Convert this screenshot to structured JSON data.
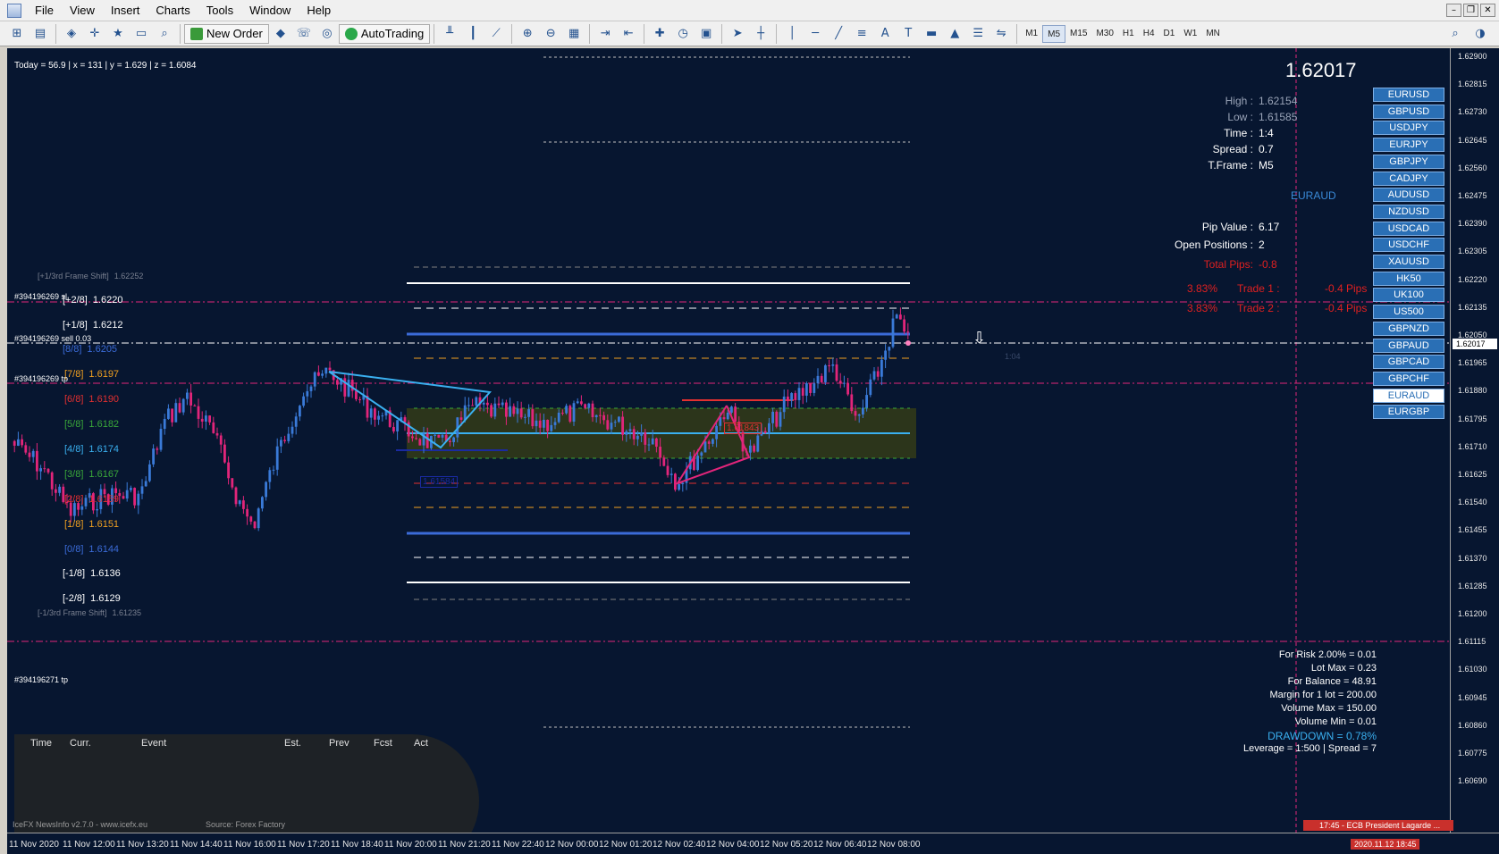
{
  "menu": [
    "File",
    "View",
    "Insert",
    "Charts",
    "Tools",
    "Window",
    "Help"
  ],
  "window_controls": [
    "–",
    "❐",
    "✕"
  ],
  "toolbar": {
    "new_order": "New Order",
    "autotrading": "AutoTrading",
    "timeframes": [
      "M1",
      "M5",
      "M15",
      "M30",
      "H1",
      "H4",
      "D1",
      "W1",
      "MN"
    ],
    "active_timeframe": "M5"
  },
  "chart": {
    "info_line": "Today = 56.9   |   x = 131   |   y = 1.629   |   z = 1.6084",
    "big_price": "1.62017",
    "symbol": "EURAUD",
    "info_panel": [
      {
        "k": "High :",
        "v": "1.62154",
        "color": "#9aa4b8"
      },
      {
        "k": "Low :",
        "v": "1.61585",
        "color": "#9aa4b8"
      },
      {
        "k": "Time :",
        "v": "1:4",
        "color": "#ffffff"
      },
      {
        "k": "Spread :",
        "v": "0.7",
        "color": "#ffffff"
      },
      {
        "k": "T.Frame :",
        "v": "M5",
        "color": "#ffffff"
      }
    ],
    "pip_value_label": "Pip Value :",
    "pip_value": "6.17",
    "open_positions_label": "Open Positions :",
    "open_positions": "2",
    "total_pips_label": "Total Pips:",
    "total_pips": "-0.8",
    "trades": [
      {
        "pct": "3.83%",
        "label": "Trade 1 :",
        "pips": "-0.4 Pips"
      },
      {
        "pct": "3.83%",
        "label": "Trade 2 :",
        "pips": "-0.4 Pips"
      }
    ],
    "symbols": [
      "EURUSD",
      "GBPUSD",
      "USDJPY",
      "EURJPY",
      "GBPJPY",
      "CADJPY",
      "AUDUSD",
      "NZDUSD",
      "USDCAD",
      "USDCHF",
      "XAUUSD",
      "HK50",
      "UK100",
      "US500",
      "GBPNZD",
      "GBPAUD",
      "GBPCAD",
      "GBPCHF",
      "EURAUD",
      "EURGBP"
    ],
    "active_symbol": "EURAUD",
    "murrey": [
      {
        "lbl": "[+1/3rd Frame Shift]",
        "val": "1.62252",
        "color": "#7a8090"
      },
      {
        "lbl": "[+2/8]",
        "val": "1.6220",
        "color": "#ffffff"
      },
      {
        "lbl": "[+1/8]",
        "val": "1.6212",
        "color": "#ffffff"
      },
      {
        "lbl": "[8/8]",
        "val": "1.6205",
        "color": "#3b6bd8"
      },
      {
        "lbl": "[7/8]",
        "val": "1.6197",
        "color": "#f0a020"
      },
      {
        "lbl": "[6/8]",
        "val": "1.6190",
        "color": "#e23030"
      },
      {
        "lbl": "[5/8]",
        "val": "1.6182",
        "color": "#3aa83a"
      },
      {
        "lbl": "[4/8]",
        "val": "1.6174",
        "color": "#3ab0f0"
      },
      {
        "lbl": "[3/8]",
        "val": "1.6167",
        "color": "#3aa83a"
      },
      {
        "lbl": "[2/8]",
        "val": "1.6159",
        "color": "#e23030"
      },
      {
        "lbl": "[1/8]",
        "val": "1.6151",
        "color": "#f0a020"
      },
      {
        "lbl": "[0/8]",
        "val": "1.6144",
        "color": "#3b6bd8"
      },
      {
        "lbl": "[-1/8]",
        "val": "1.6136",
        "color": "#ffffff"
      },
      {
        "lbl": "[-2/8]",
        "val": "1.6129",
        "color": "#ffffff"
      },
      {
        "lbl": "[-1/3rd Frame Shift]",
        "val": "1.61235",
        "color": "#7a8090"
      }
    ],
    "order_labels": [
      {
        "text": "#394196269 sl"
      },
      {
        "text": "#394196269 sell 0.03"
      },
      {
        "text": "#394196269 tp"
      },
      {
        "text": "#394196271 tp"
      }
    ],
    "pivot_low_label": "1.61584",
    "pivot_high_label": "1.61843",
    "bar_time_label": "1:04",
    "calendar_headers": [
      "Time",
      "Curr.",
      "Event",
      "Est.",
      "Prev",
      "Fcst",
      "Act"
    ],
    "calendar_footer": "IceFX NewsInfo v2.7.0  -  www.icefx.eu",
    "calendar_source": "Source: Forex Factory",
    "risk": [
      {
        "t": "For Risk 2.00% = 0.01",
        "color": "#ffffff"
      },
      {
        "t": "Lot Max = 0.23",
        "color": "#ffffff"
      },
      {
        "t": "For Balance = 48.91",
        "color": "#ffffff"
      },
      {
        "t": "Margin for 1 lot = 200.00",
        "color": "#ffffff"
      },
      {
        "t": "Volume Max = 150.00",
        "color": "#ffffff"
      },
      {
        "t": "Volume Min = 0.01",
        "color": "#ffffff"
      },
      {
        "t": "DRAWDOWN =  0.78%",
        "color": "#3ab0f0"
      },
      {
        "t": "Leverage = 1:500 | Spread = 7",
        "color": "#ffffff"
      }
    ]
  },
  "price_ticks": [
    "1.62900",
    "1.62815",
    "1.62730",
    "1.62645",
    "1.62560",
    "1.62475",
    "1.62390",
    "1.62305",
    "1.62220",
    "1.62135",
    "1.62050",
    "1.62017",
    "1.61965",
    "1.61880",
    "1.61795",
    "1.61710",
    "1.61625",
    "1.61540",
    "1.61455",
    "1.61370",
    "1.61285",
    "1.61200",
    "1.61115",
    "1.61030",
    "1.60945",
    "1.60860",
    "1.60775",
    "1.60690"
  ],
  "current_price_tick": "1.62017",
  "time_labels": [
    "11 Nov 2020",
    "11 Nov 12:00",
    "11 Nov 13:20",
    "11 Nov 14:40",
    "11 Nov 16:00",
    "11 Nov 17:20",
    "11 Nov 18:40",
    "11 Nov 20:00",
    "11 Nov 21:20",
    "11 Nov 22:40",
    "12 Nov 00:00",
    "12 Nov 01:20",
    "12 Nov 02:40",
    "12 Nov 04:00",
    "12 Nov 05:20",
    "12 Nov 06:40",
    "12 Nov 08:00"
  ],
  "news_ticker": "17:45 - ECB President Lagarde ...",
  "server_time": "2020.11.12 18:45"
}
